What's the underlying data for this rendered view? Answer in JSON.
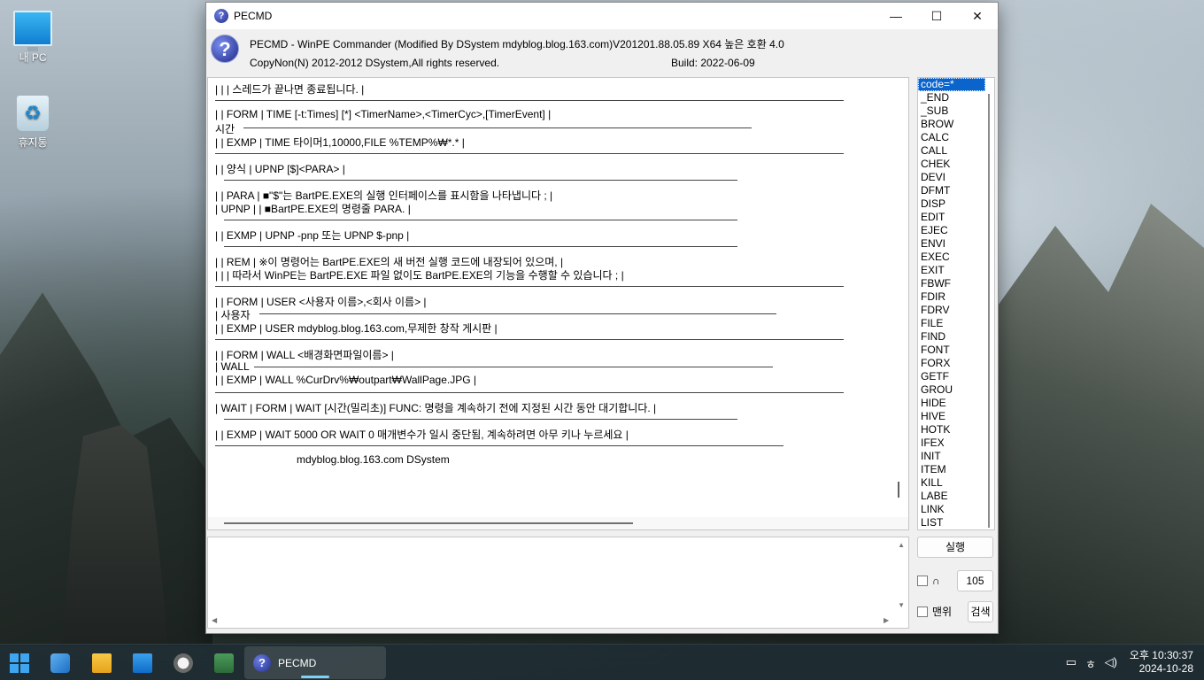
{
  "desktop": {
    "icons": [
      {
        "label": "내 PC",
        "icon": "computer-icon"
      },
      {
        "label": "휴지통",
        "icon": "recycle-bin-icon"
      }
    ]
  },
  "window": {
    "title": "PECMD",
    "header_line1": "PECMD - WinPE Commander (Modified By DSystem mdyblog.blog.163.com)V201201.88.05.89 X64 높은 호환 4.0",
    "header_line2": "CopyNon(N) 2012-2012 DSystem,All rights reserved.",
    "build": "Build: 2022-06-09",
    "controls": {
      "minimize": "—",
      "maximize": "☐",
      "close": "✕"
    }
  },
  "output": {
    "lines": [
      "|   |   | 스레드가 끝나면 종료됩니다.  |",
      "|   | FORM | TIME [-t:Times] [*] <TimerName>,<TimerCyc>,[TimerEvent]  |",
      "시간",
      "|   | EXMP | TIME 타이머1,10000,FILE %TEMP%₩*.*  |",
      "|   | 양식  | UPNP [$]<PARA>  |",
      "|   | PARA | ■\"$\"는 BartPE.EXE의 실행 인터페이스를 표시함을 나타냅니다 ;   |",
      "| UPNP |     | ■BartPE.EXE의 명령줄 PARA.  |",
      "|   | EXMP | UPNP -pnp 또는 UPNP $-pnp  |",
      "|   | REM   | ※이 명령어는 BartPE.EXE의 새 버전 실행 코드에 내장되어 있으며,  |",
      "|   |    |  따라서 WinPE는 BartPE.EXE 파일 없이도 BartPE.EXE의 기능을 수행할 수 있습니다 ;   |",
      "|   | FORM | USER <사용자 이름>,<회사 이름>  |",
      "| 사용자",
      "|   | EXMP | USER mdyblog.blog.163.com,무제한 창작 게시판  |",
      "|   | FORM | WALL <배경화면파일이름>  |",
      "| WALL",
      "|   | EXMP | WALL %CurDrv%₩outpart₩WallPage.JPG  |",
      "| WAIT | FORM | WAIT [시간(밀리초)] FUNC: 명령을 계속하기 전에 지정된 시간 동안 대기합니다.  |",
      "|   | EXMP | WAIT 5000 OR WAIT 0 매개변수가 일시 중단됨, 계속하려면 아무 키나 누르세요  |",
      "mdyblog.blog.163.com DSystem"
    ]
  },
  "command_list": {
    "selected": "code=*",
    "items": [
      "code=*",
      "_END",
      "_SUB",
      "BROW",
      "CALC",
      "CALL",
      "CHEK",
      "DEVI",
      "DFMT",
      "DISP",
      "EDIT",
      "EJEC",
      "ENVI",
      "EXEC",
      "EXIT",
      "FBWF",
      "FDIR",
      "FDRV",
      "FILE",
      "FIND",
      "FONT",
      "FORX",
      "GETF",
      "GROU",
      "HIDE",
      "HIVE",
      "HOTK",
      "IFEX",
      "INIT",
      "ITEM",
      "KILL",
      "LABE",
      "LINK",
      "LIST"
    ]
  },
  "controls": {
    "run_label": "실행",
    "checkbox1_label": "∩",
    "number_value": "105",
    "checkbox2_label": "맨위",
    "search_label": "검색"
  },
  "taskbar": {
    "active_app": "PECMD",
    "time": "오후 10:30:37",
    "date": "2024-10-28"
  }
}
